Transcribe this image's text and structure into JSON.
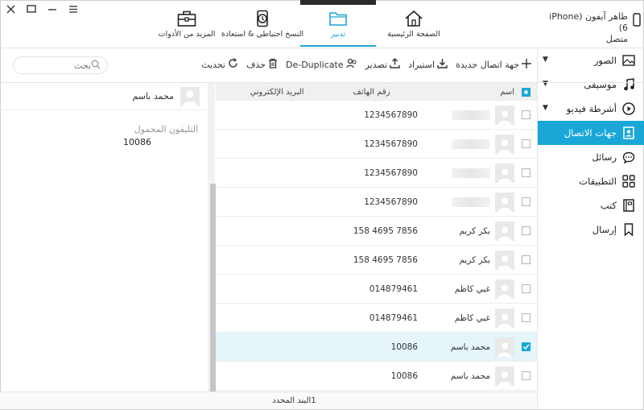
{
  "window": {
    "controls": [
      "close-icon",
      "maximize-icon",
      "minimize-icon",
      "menu-icon"
    ]
  },
  "nav": {
    "tabs": [
      {
        "id": "tools",
        "label": "المزيد من الأدوات",
        "icon": "toolbox-icon"
      },
      {
        "id": "backup",
        "label": "النسخ احتياطي & استعادة",
        "icon": "backup-icon"
      },
      {
        "id": "manage",
        "label": "تدبير",
        "icon": "folder-icon",
        "active": true
      },
      {
        "id": "home",
        "label": "الصفحة الرئيسية",
        "icon": "home-icon"
      }
    ]
  },
  "device": {
    "name": "طاهر آيفون (iPhone 6)",
    "status": "متصل"
  },
  "sidebar": {
    "items": [
      {
        "label": "الصور",
        "icon": "photo-icon",
        "expand": true
      },
      {
        "label": "موسيقى",
        "icon": "music-icon",
        "expand": true
      },
      {
        "label": "أشرطة فيديو",
        "icon": "video-icon",
        "expand": true
      },
      {
        "label": "جهات الاتصال",
        "icon": "contacts-icon",
        "active": true
      },
      {
        "label": "رسائل",
        "icon": "message-icon"
      },
      {
        "label": "التطبيقات",
        "icon": "apps-icon"
      },
      {
        "label": "كتب",
        "icon": "book-icon"
      },
      {
        "label": "إرسال",
        "icon": "bookmark-icon"
      }
    ]
  },
  "toolbar": {
    "new_contact": "جهة اتصال جديدة",
    "import": "استيراد",
    "export": "تصدير",
    "dedupe": "De-Duplicate",
    "delete": "حذف",
    "refresh": "تحديث"
  },
  "search": {
    "placeholder": "بحث"
  },
  "table": {
    "headers": {
      "name": "اسم",
      "phone": "رقم الهاتف",
      "email": "البريد الإلكتروني"
    },
    "rows": [
      {
        "name": "",
        "phone": "1234567890",
        "email": "",
        "checked": false,
        "blurred": true
      },
      {
        "name": "",
        "phone": "1234567890",
        "email": "",
        "checked": false,
        "blurred": true
      },
      {
        "name": "",
        "phone": "1234567890",
        "email": "",
        "checked": false,
        "blurred": true
      },
      {
        "name": "",
        "phone": "1234567890",
        "email": "",
        "checked": false,
        "blurred": true
      },
      {
        "name": "بكر كريم",
        "phone": "158 4695 7856",
        "email": "",
        "checked": false
      },
      {
        "name": "بكر كريم",
        "phone": "158 4695 7856",
        "email": "",
        "checked": false
      },
      {
        "name": "غبي كاظم",
        "phone": "014879461",
        "email": "",
        "checked": false
      },
      {
        "name": "غبي كاظم",
        "phone": "014879461",
        "email": "",
        "checked": false
      },
      {
        "name": "محمد باسم",
        "phone": "10086",
        "email": "",
        "checked": true,
        "selected": true
      },
      {
        "name": "محمد باسم",
        "phone": "10086",
        "email": "",
        "checked": false
      }
    ]
  },
  "detail": {
    "name": "محمد باسم",
    "field_label": "التليفون المحمول",
    "field_value": "10086"
  },
  "status": {
    "text": "1البند المحدد"
  },
  "colors": {
    "accent": "#1aa7d8"
  }
}
